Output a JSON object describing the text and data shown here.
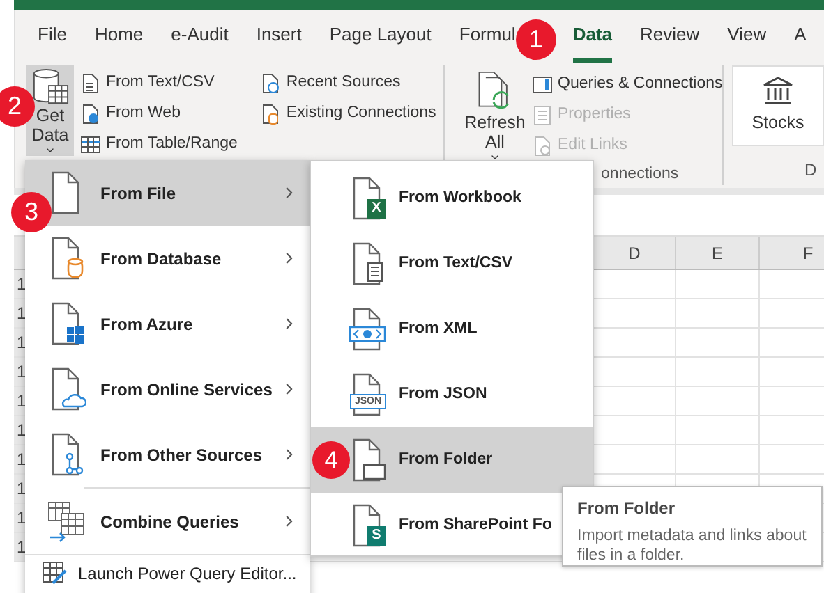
{
  "ribbon_tabs": [
    {
      "label": "File",
      "selected": false
    },
    {
      "label": "Home",
      "selected": false
    },
    {
      "label": "e-Audit",
      "selected": false
    },
    {
      "label": "Insert",
      "selected": false
    },
    {
      "label": "Page Layout",
      "selected": false
    },
    {
      "label": "Formul",
      "selected": false
    },
    {
      "label": "Data",
      "selected": true
    },
    {
      "label": "Review",
      "selected": false
    },
    {
      "label": "View",
      "selected": false
    },
    {
      "label": "A",
      "selected": false
    }
  ],
  "get_data_button": {
    "label": "Get Data",
    "selected": true
  },
  "get_group_columns": [
    [
      {
        "label": "From Text/CSV",
        "kind": "text"
      },
      {
        "label": "From Web",
        "kind": "web"
      },
      {
        "label": "From Table/Range",
        "kind": "table"
      }
    ],
    [
      {
        "label": "Recent Sources",
        "kind": "recent"
      },
      {
        "label": "Existing Connections",
        "kind": "existing"
      }
    ]
  ],
  "refresh_button": {
    "label": "Refresh All"
  },
  "connection_items": [
    {
      "label": "Queries & Connections",
      "kind": "queries",
      "disabled": false
    },
    {
      "label": "Properties",
      "kind": "properties",
      "disabled": true
    },
    {
      "label": "Edit Links",
      "kind": "links",
      "disabled": true
    }
  ],
  "connections_group_label": "onnections",
  "stocks_button": {
    "label": "Stocks"
  },
  "next_group_label": "D",
  "sheet": {
    "columns": [
      "D",
      "E",
      "F"
    ],
    "row_numbers": [
      "1",
      "1",
      "1",
      "1",
      "1",
      "1",
      "1",
      "1",
      "1",
      "1"
    ]
  },
  "get_data_menu": {
    "items": [
      {
        "label": "From File",
        "kind": "file",
        "selected": true,
        "separator_before": false
      },
      {
        "label": "From Database",
        "kind": "database",
        "selected": false,
        "separator_before": false
      },
      {
        "label": "From Azure",
        "kind": "azure",
        "selected": false,
        "separator_before": false
      },
      {
        "label": "From Online Services",
        "kind": "online",
        "selected": false,
        "separator_before": false
      },
      {
        "label": "From Other Sources",
        "kind": "other",
        "selected": false,
        "separator_before": false
      },
      {
        "label": "Combine Queries",
        "kind": "combine",
        "selected": false,
        "separator_before": true
      }
    ],
    "footer_item": {
      "label": "Launch Power Query Editor..."
    }
  },
  "from_file_submenu": {
    "items": [
      {
        "label": "From Workbook",
        "kind": "workbook",
        "icon_text": "X",
        "selected": false
      },
      {
        "label": "From Text/CSV",
        "kind": "text",
        "selected": false
      },
      {
        "label": "From XML",
        "kind": "xml",
        "selected": false
      },
      {
        "label": "From JSON",
        "kind": "json",
        "icon_text": "JSON",
        "selected": false
      },
      {
        "label": "From Folder",
        "kind": "folder",
        "selected": true,
        "step_badge": "4"
      },
      {
        "label": "From SharePoint Fo",
        "kind": "sharepoint",
        "icon_text": "S",
        "selected": false
      }
    ]
  },
  "tooltip": {
    "title": "From Folder",
    "description": "Import metadata and links about files in a folder."
  },
  "step_badges": [
    "1",
    "2",
    "3"
  ]
}
